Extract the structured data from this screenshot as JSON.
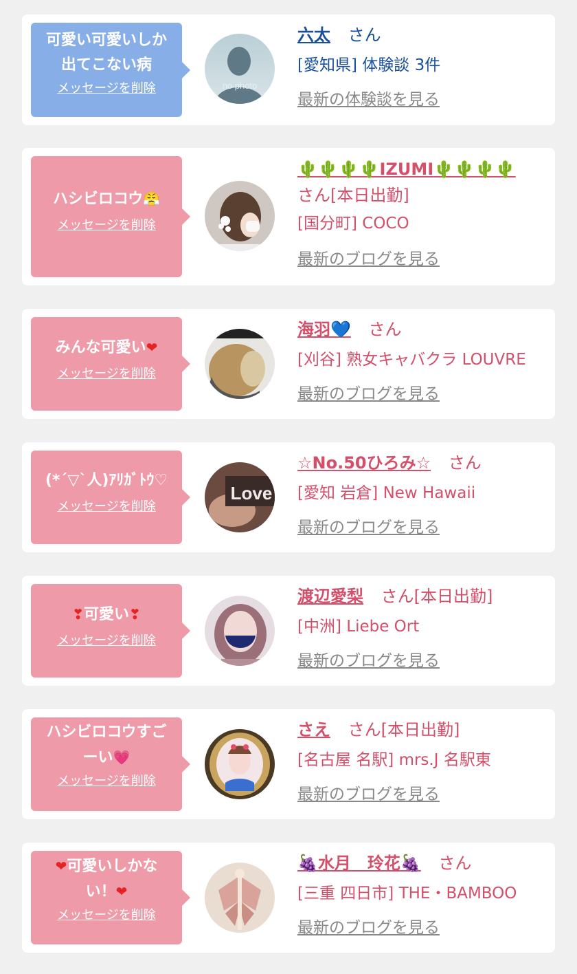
{
  "delete_label": "メッセージを削除",
  "items": [
    {
      "bubble_text": "可愛い可愛いしか\n出てこない病",
      "name": "六太",
      "san": "さん",
      "extra": "",
      "detail": "[愛知県] 体験談 3件",
      "more": "最新の体験談を見る",
      "avatar": "no-photo",
      "avatar_text": "no photo"
    },
    {
      "bubble_text": "ハシビロコウ",
      "bubble_icon": "😤",
      "name_prefix": "🌵🌵🌵🌵",
      "name": "IZUMI",
      "name_suffix": "🌵🌵🌵🌵",
      "san": "さん[本日出勤]",
      "detail": "[国分町] COCO",
      "more": "最新のブログを見る",
      "avatar": "photo-hair-clip"
    },
    {
      "bubble_text": "みんな可愛い",
      "bubble_icon": "❤",
      "name": "海羽",
      "name_suffix": "💙",
      "san": "さん",
      "detail": "[刈谷] 熟女キャバクラ LOUVRE",
      "more": "最新のブログを見る",
      "avatar": "photo-blonde-hair"
    },
    {
      "bubble_text": "(*´▽`人)ｱﾘｶﾞﾄｳ♡",
      "name": "☆No.50ひろみ☆",
      "san": "さん",
      "detail": "[愛知 岩倉] New Hawaii",
      "more": "最新のブログを見る",
      "avatar": "photo-love"
    },
    {
      "bubble_icon_left": "❣",
      "bubble_text": "可愛い",
      "bubble_icon": "❣",
      "name": "渡辺愛梨",
      "san": "さん[本日出勤]",
      "detail": "[中洲] Liebe Ort",
      "more": "最新のブログを見る",
      "avatar": "photo-mask"
    },
    {
      "bubble_text": "ハシビロコウすご\nーい",
      "bubble_icon": "💗",
      "name": "さえ",
      "san": "さん[本日出勤]",
      "detail": "[名古屋 名駅] mrs.J 名駅東",
      "more": "最新のブログを見る",
      "avatar": "photo-frame"
    },
    {
      "bubble_icon_left": "❤",
      "bubble_text": "可愛いしかな\nい！",
      "bubble_icon": "❤",
      "name_prefix": "🍇",
      "name": "水月　玲花",
      "name_suffix": "🍇",
      "san": "さん",
      "detail": "[三重 四日市] THE・BAMBOO",
      "more": "最新のブログを見る",
      "avatar": "photo-butterfly"
    }
  ],
  "colors": {
    "background": "#f0f0f0",
    "card": "#ffffff",
    "bubble_blue": "#88aee8",
    "bubble_pink": "#ee9aa8",
    "link_blue": "#1a4f9a",
    "link_pink": "#d34f6a",
    "muted": "#888888"
  }
}
